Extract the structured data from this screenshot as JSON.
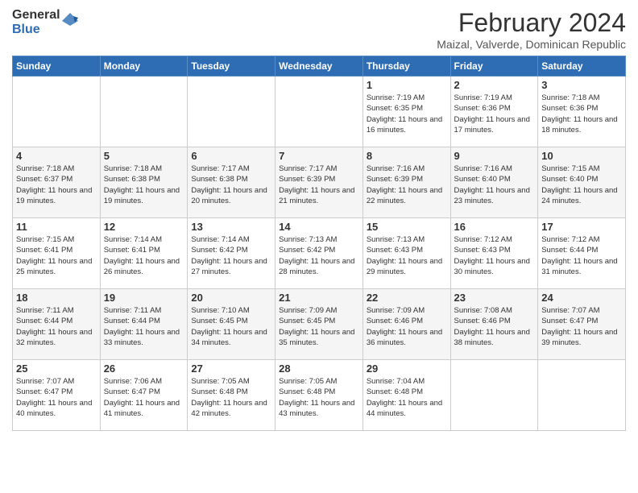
{
  "logo": {
    "text_general": "General",
    "text_blue": "Blue"
  },
  "header": {
    "title": "February 2024",
    "subtitle": "Maizal, Valverde, Dominican Republic"
  },
  "weekdays": [
    "Sunday",
    "Monday",
    "Tuesday",
    "Wednesday",
    "Thursday",
    "Friday",
    "Saturday"
  ],
  "weeks": [
    [
      {
        "day": "",
        "info": ""
      },
      {
        "day": "",
        "info": ""
      },
      {
        "day": "",
        "info": ""
      },
      {
        "day": "",
        "info": ""
      },
      {
        "day": "1",
        "info": "Sunrise: 7:19 AM\nSunset: 6:35 PM\nDaylight: 11 hours and 16 minutes."
      },
      {
        "day": "2",
        "info": "Sunrise: 7:19 AM\nSunset: 6:36 PM\nDaylight: 11 hours and 17 minutes."
      },
      {
        "day": "3",
        "info": "Sunrise: 7:18 AM\nSunset: 6:36 PM\nDaylight: 11 hours and 18 minutes."
      }
    ],
    [
      {
        "day": "4",
        "info": "Sunrise: 7:18 AM\nSunset: 6:37 PM\nDaylight: 11 hours and 19 minutes."
      },
      {
        "day": "5",
        "info": "Sunrise: 7:18 AM\nSunset: 6:38 PM\nDaylight: 11 hours and 19 minutes."
      },
      {
        "day": "6",
        "info": "Sunrise: 7:17 AM\nSunset: 6:38 PM\nDaylight: 11 hours and 20 minutes."
      },
      {
        "day": "7",
        "info": "Sunrise: 7:17 AM\nSunset: 6:39 PM\nDaylight: 11 hours and 21 minutes."
      },
      {
        "day": "8",
        "info": "Sunrise: 7:16 AM\nSunset: 6:39 PM\nDaylight: 11 hours and 22 minutes."
      },
      {
        "day": "9",
        "info": "Sunrise: 7:16 AM\nSunset: 6:40 PM\nDaylight: 11 hours and 23 minutes."
      },
      {
        "day": "10",
        "info": "Sunrise: 7:15 AM\nSunset: 6:40 PM\nDaylight: 11 hours and 24 minutes."
      }
    ],
    [
      {
        "day": "11",
        "info": "Sunrise: 7:15 AM\nSunset: 6:41 PM\nDaylight: 11 hours and 25 minutes."
      },
      {
        "day": "12",
        "info": "Sunrise: 7:14 AM\nSunset: 6:41 PM\nDaylight: 11 hours and 26 minutes."
      },
      {
        "day": "13",
        "info": "Sunrise: 7:14 AM\nSunset: 6:42 PM\nDaylight: 11 hours and 27 minutes."
      },
      {
        "day": "14",
        "info": "Sunrise: 7:13 AM\nSunset: 6:42 PM\nDaylight: 11 hours and 28 minutes."
      },
      {
        "day": "15",
        "info": "Sunrise: 7:13 AM\nSunset: 6:43 PM\nDaylight: 11 hours and 29 minutes."
      },
      {
        "day": "16",
        "info": "Sunrise: 7:12 AM\nSunset: 6:43 PM\nDaylight: 11 hours and 30 minutes."
      },
      {
        "day": "17",
        "info": "Sunrise: 7:12 AM\nSunset: 6:44 PM\nDaylight: 11 hours and 31 minutes."
      }
    ],
    [
      {
        "day": "18",
        "info": "Sunrise: 7:11 AM\nSunset: 6:44 PM\nDaylight: 11 hours and 32 minutes."
      },
      {
        "day": "19",
        "info": "Sunrise: 7:11 AM\nSunset: 6:44 PM\nDaylight: 11 hours and 33 minutes."
      },
      {
        "day": "20",
        "info": "Sunrise: 7:10 AM\nSunset: 6:45 PM\nDaylight: 11 hours and 34 minutes."
      },
      {
        "day": "21",
        "info": "Sunrise: 7:09 AM\nSunset: 6:45 PM\nDaylight: 11 hours and 35 minutes."
      },
      {
        "day": "22",
        "info": "Sunrise: 7:09 AM\nSunset: 6:46 PM\nDaylight: 11 hours and 36 minutes."
      },
      {
        "day": "23",
        "info": "Sunrise: 7:08 AM\nSunset: 6:46 PM\nDaylight: 11 hours and 38 minutes."
      },
      {
        "day": "24",
        "info": "Sunrise: 7:07 AM\nSunset: 6:47 PM\nDaylight: 11 hours and 39 minutes."
      }
    ],
    [
      {
        "day": "25",
        "info": "Sunrise: 7:07 AM\nSunset: 6:47 PM\nDaylight: 11 hours and 40 minutes."
      },
      {
        "day": "26",
        "info": "Sunrise: 7:06 AM\nSunset: 6:47 PM\nDaylight: 11 hours and 41 minutes."
      },
      {
        "day": "27",
        "info": "Sunrise: 7:05 AM\nSunset: 6:48 PM\nDaylight: 11 hours and 42 minutes."
      },
      {
        "day": "28",
        "info": "Sunrise: 7:05 AM\nSunset: 6:48 PM\nDaylight: 11 hours and 43 minutes."
      },
      {
        "day": "29",
        "info": "Sunrise: 7:04 AM\nSunset: 6:48 PM\nDaylight: 11 hours and 44 minutes."
      },
      {
        "day": "",
        "info": ""
      },
      {
        "day": "",
        "info": ""
      }
    ]
  ]
}
